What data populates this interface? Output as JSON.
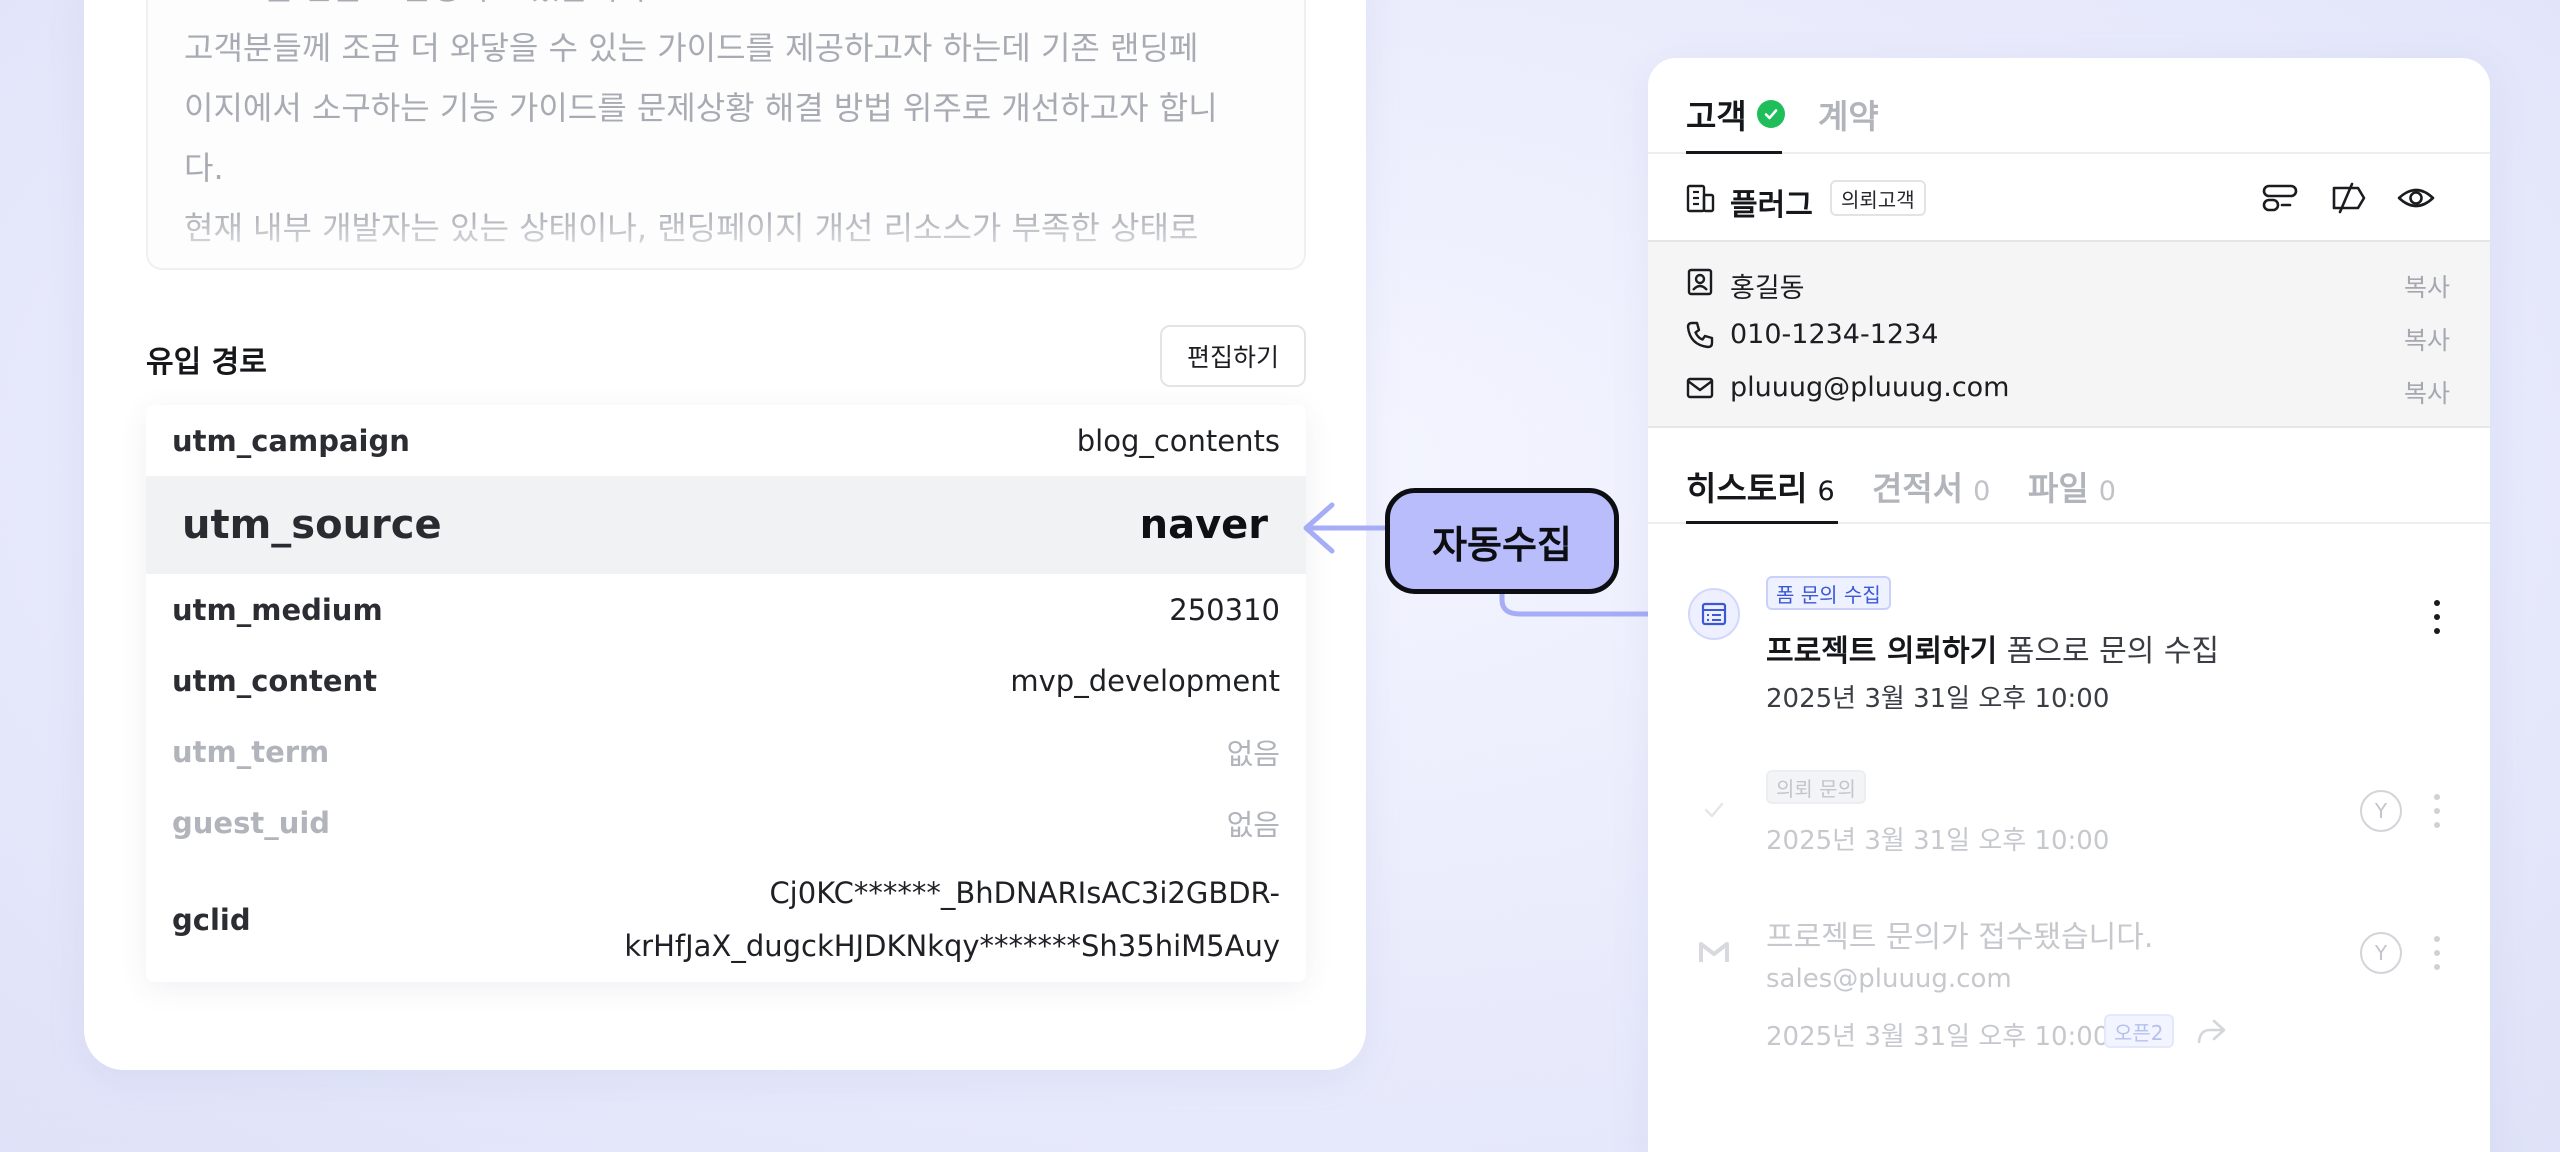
{
  "memo": {
    "lines": [
      "SaaS를 만들고 운영하고 있습니다.",
      "고객분들께 조금 더 와닿을 수 있는 가이드를 제공하고자 하는데 기존 랜딩페",
      "이지에서 소구하는 기능 가이드를 문제상황 해결 방법 위주로 개선하고자 합니",
      "다.",
      "현재 내부 개발자는 있는 상태이나, 랜딩페이지 개선 리소스가 부족한 상태로"
    ]
  },
  "inflow": {
    "title": "유입 경로",
    "edit_label": "편집하기",
    "rows": [
      {
        "key": "utm_campaign",
        "value": "blog_contents"
      },
      {
        "key": "utm_source",
        "value": "naver"
      },
      {
        "key": "utm_medium",
        "value": "250310"
      },
      {
        "key": "utm_content",
        "value": "mvp_development"
      },
      {
        "key": "utm_term",
        "value": "없음"
      },
      {
        "key": "guest_uid",
        "value": "없음"
      },
      {
        "key": "gclid",
        "value_line1": "Cj0KC******_BhDNARIsAC3i2GBDR-",
        "value_line2": "krHfJaX_dugckHJDKNkqy*******Sh35hiM5Auy"
      }
    ]
  },
  "auto_collect_label": "자동수집",
  "panel": {
    "tabs": [
      {
        "label": "고객"
      },
      {
        "label": "계약"
      }
    ],
    "company": {
      "name": "플러그",
      "tag": "의뢰고객"
    },
    "contacts": [
      {
        "icon": "contact-card-icon",
        "text": "홍길동",
        "copy": "복사"
      },
      {
        "icon": "phone-icon",
        "text": "010-1234-1234",
        "copy": "복사"
      },
      {
        "icon": "mail-icon",
        "text": "pluuug@pluuug.com",
        "copy": "복사"
      }
    ],
    "history_tabs": [
      {
        "label": "히스토리",
        "count": "6"
      },
      {
        "label": "견적서",
        "count": "0"
      },
      {
        "label": "파일",
        "count": "0"
      }
    ],
    "timeline": [
      {
        "chip": "폼 문의 수집",
        "title_bold": "프로젝트 의뢰하기",
        "title_rest": " 폼으로 문의 수집",
        "date": "2025년 3월 31일 오후 10:00"
      },
      {
        "chip": "의뢰 문의",
        "date": "2025년 3월 31일 오후 10:00",
        "avatar": "Y"
      },
      {
        "title": "프로젝트 문의가 접수됐습니다.",
        "email": "sales@pluuug.com",
        "date": "2025년 3월 31일 오후 10:00",
        "chip": "오픈2",
        "avatar": "Y"
      }
    ]
  }
}
